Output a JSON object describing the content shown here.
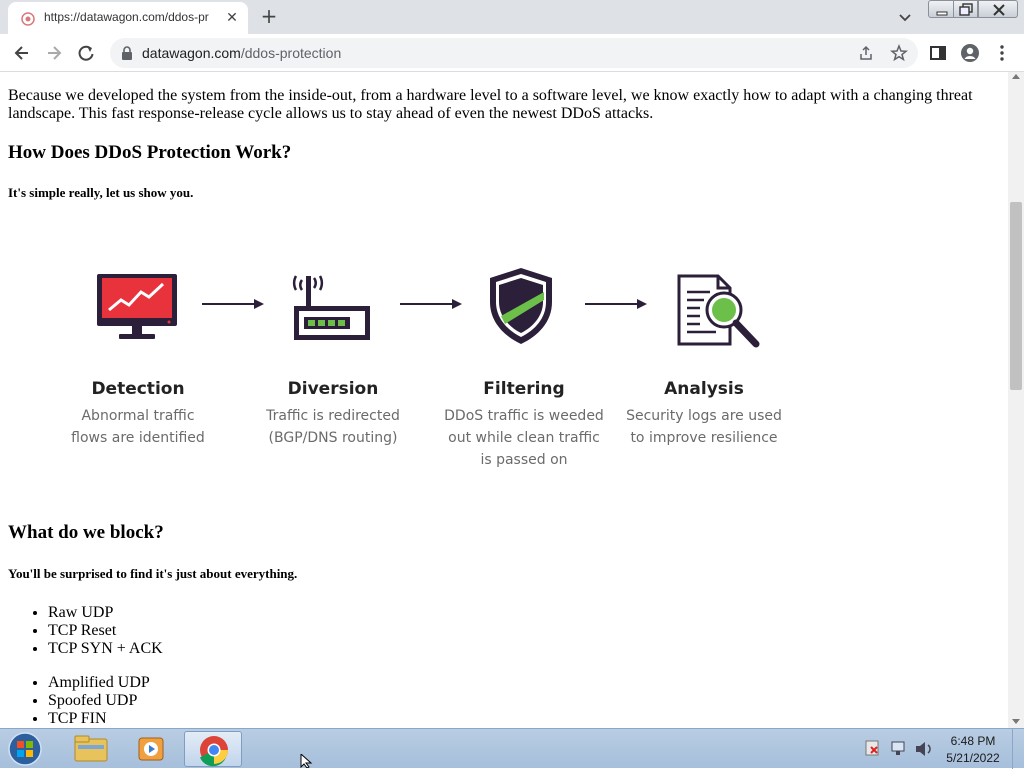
{
  "browser": {
    "tab_title": "https://datawagon.com/ddos-pr",
    "tab_close": "✕",
    "new_tab": "+",
    "url_host": "datawagon.com",
    "url_path": "/ddos-protection"
  },
  "page": {
    "intro": "Because we developed the system from the inside-out, from a hardware level to a software level, we know exactly how to adapt with a changing threat landscape. This fast response-release cycle allows us to stay ahead of even the newest DDoS attacks.",
    "how_heading": "How Does DDoS Protection Work?",
    "how_sub": "It's simple really, let us show you.",
    "steps": [
      {
        "title": "Detection",
        "desc": "Abnormal traffic flows are identified",
        "icon": "monitor-chart-icon"
      },
      {
        "title": "Diversion",
        "desc": "Traffic is redirected (BGP/DNS routing)",
        "icon": "router-icon"
      },
      {
        "title": "Filtering",
        "desc": "DDoS traffic is weeded out while clean traffic is passed on",
        "icon": "shield-icon"
      },
      {
        "title": "Analysis",
        "desc": "Security logs are used to improve resilience",
        "icon": "document-magnifier-icon"
      }
    ],
    "block_heading": "What do we block?",
    "block_sub": "You'll be surprised to find it's just about everything.",
    "block_list_1": [
      "Raw UDP",
      "TCP Reset",
      "TCP SYN + ACK"
    ],
    "block_list_2": [
      "Amplified UDP",
      "Spoofed UDP",
      "TCP FIN"
    ]
  },
  "colors": {
    "detection_red": "#e8323c",
    "icon_dark": "#2b1f3a",
    "filter_green": "#6cc04a"
  },
  "taskbar": {
    "time": "6:48 PM",
    "date": "5/21/2022"
  }
}
